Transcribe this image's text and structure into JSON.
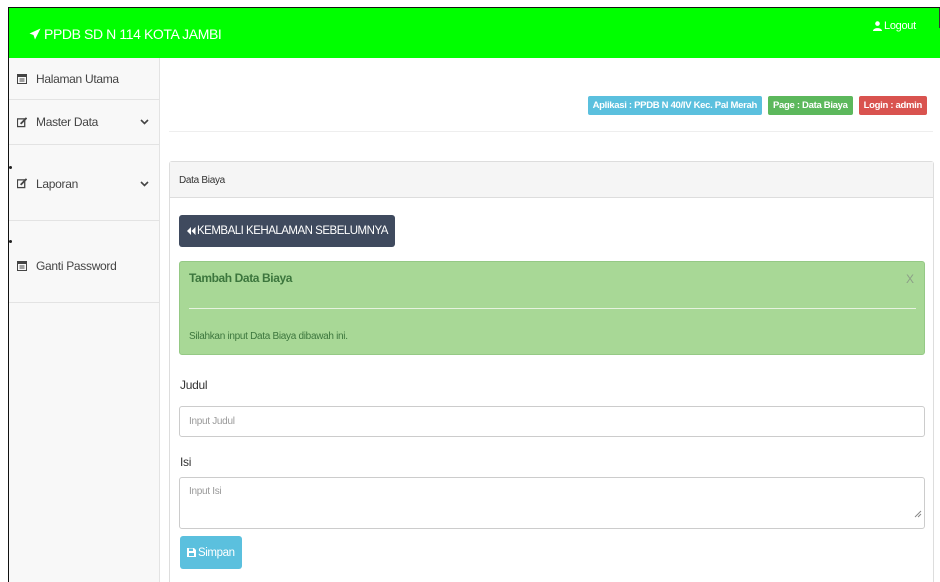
{
  "topbar": {
    "brand": "PPDB SD N 114 KOTA JAMBI",
    "logout": "Logout",
    "bg_color": "#00ff00"
  },
  "sidebar": {
    "items": [
      {
        "label": "Halaman Utama",
        "icon": "calendar-icon"
      },
      {
        "label": "Master Data",
        "icon": "edit-icon",
        "has_submenu": true
      },
      {
        "label": "Laporan",
        "icon": "edit-icon",
        "has_submenu": true
      },
      {
        "label": "Ganti Password",
        "icon": "calendar-icon"
      }
    ]
  },
  "header_labels": {
    "aplikasi": "Aplikasi : PPDB N 40/IV Kec. Pal Merah",
    "page": "Page : Data Biaya",
    "login": "Login : admin"
  },
  "panel": {
    "title": "Data Biaya",
    "back_button": "KEMBALI KEHALAMAN SEBELUMNYA",
    "alert": {
      "title": "Tambah Data Biaya",
      "close": "X",
      "text": "Silahkan input Data Biaya dibawah ini."
    },
    "form": {
      "judul_label": "Judul",
      "judul_placeholder": "Input Judul",
      "isi_label": "Isi",
      "isi_placeholder": "Input Isi",
      "save_button": "Simpan"
    }
  }
}
